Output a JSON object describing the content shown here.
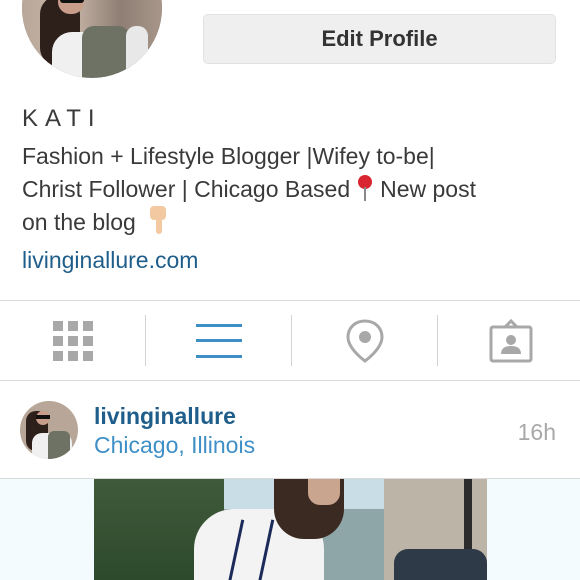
{
  "profile": {
    "edit_button": "Edit Profile",
    "name": "KATI",
    "bio_line1": "Fashion + Lifestyle Blogger |Wifey to-be|",
    "bio_line2a": "Christ Follower | Chicago Based",
    "bio_line2b": "New post",
    "bio_line3": "on the blog",
    "website": "livinginallure.com",
    "pin_emoji_icon": "round-pushpin-icon",
    "hand_emoji_icon": "pointing-down-hand-icon"
  },
  "tabs": [
    {
      "icon": "grid-icon",
      "active": false
    },
    {
      "icon": "list-icon",
      "active": true
    },
    {
      "icon": "location-pin-icon",
      "active": false
    },
    {
      "icon": "tagged-photos-icon",
      "active": false
    }
  ],
  "post": {
    "username": "livinginallure",
    "location": "Chicago, Illinois",
    "time": "16h"
  },
  "colors": {
    "link": "#1f5e8a",
    "location_link": "#3f8fc7",
    "active_tab": "#3f8fc7",
    "inactive_tab": "#a8a8a8",
    "button_bg": "#efefef"
  }
}
